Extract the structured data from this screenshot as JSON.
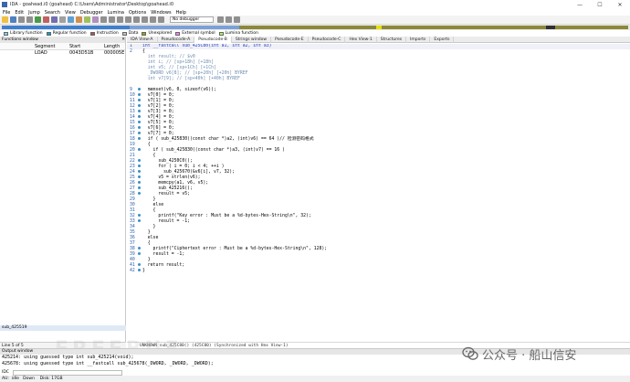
{
  "window": {
    "title": "IDA - goahead.i0 (goahead) C:\\Users\\Administrator\\Desktop\\goahead.i0",
    "controls": [
      "—",
      "☐",
      "✕"
    ]
  },
  "menu": [
    "File",
    "Edit",
    "Jump",
    "Search",
    "View",
    "Debugger",
    "Lumina",
    "Options",
    "Windows",
    "Help"
  ],
  "toolbar": {
    "debugger_select": "No debugger"
  },
  "legend": [
    {
      "label": "Library function",
      "color": "#7fd0ff"
    },
    {
      "label": "Regular function",
      "color": "#00a0d8"
    },
    {
      "label": "Instruction",
      "color": "#b05050"
    },
    {
      "label": "Data",
      "color": "#c0c0c0"
    },
    {
      "label": "Unexplored",
      "color": "#8fa800"
    },
    {
      "label": "External symbol",
      "color": "#ff80ff"
    },
    {
      "label": "Lumina function",
      "color": "#a0ff60"
    }
  ],
  "functions_window": {
    "title": "Functions window",
    "columns": [
      "Function name",
      "Segment",
      "Start",
      "Length"
    ],
    "rows": [
      {
        "name": "",
        "segment": "LOAD",
        "start": "0043D51B",
        "length": "000005E"
      }
    ],
    "selected": "sub_425519",
    "status": "Line 5 of 5"
  },
  "tabs": [
    {
      "label": "IDA View-A",
      "active": false
    },
    {
      "label": "Pseudocode-A",
      "active": false
    },
    {
      "label": "Pseudocode-B",
      "active": true
    },
    {
      "label": "Strings window",
      "active": false
    },
    {
      "label": "Pseudocode-E",
      "active": false
    },
    {
      "label": "Pseudocode-C",
      "active": false
    },
    {
      "label": "Hex View-1",
      "active": false
    },
    {
      "label": "Structures",
      "active": false
    },
    {
      "label": "Imports",
      "active": false
    },
    {
      "label": "Exports",
      "active": false
    }
  ],
  "code_lines": [
    {
      "n": "1",
      "dot": false,
      "text": "int __fastcall sub_425C80(int a1, int a2, int a3)",
      "cls": "sel"
    },
    {
      "n": "2",
      "dot": false,
      "text": "{"
    },
    {
      "n": "",
      "dot": false,
      "text": "  int result; // $v0",
      "cls": "grey"
    },
    {
      "n": "",
      "dot": false,
      "text": "  int i; // [sp+18h] [+18h]",
      "cls": "grey"
    },
    {
      "n": "",
      "dot": false,
      "text": "  int v5; // [sp+1Ch] [+1Ch]",
      "cls": "grey"
    },
    {
      "n": "",
      "dot": false,
      "text": "  _DWORD v6[8]; // [sp+20h] [+20h] BYREF",
      "cls": "grey"
    },
    {
      "n": "",
      "dot": false,
      "text": "  int v7[9]; // [sp+40h] [+40h] BYREF",
      "cls": "grey"
    },
    {
      "n": "",
      "dot": false,
      "text": ""
    },
    {
      "n": "9",
      "dot": true,
      "text": "  memset(v6, 0, sizeof(v6));"
    },
    {
      "n": "10",
      "dot": true,
      "text": "  v7[0] = 0;"
    },
    {
      "n": "11",
      "dot": true,
      "text": "  v7[1] = 0;"
    },
    {
      "n": "12",
      "dot": true,
      "text": "  v7[2] = 0;"
    },
    {
      "n": "13",
      "dot": true,
      "text": "  v7[3] = 0;"
    },
    {
      "n": "14",
      "dot": true,
      "text": "  v7[4] = 0;"
    },
    {
      "n": "15",
      "dot": true,
      "text": "  v7[5] = 0;"
    },
    {
      "n": "16",
      "dot": true,
      "text": "  v7[6] = 0;"
    },
    {
      "n": "17",
      "dot": true,
      "text": "  v7[7] = 0;"
    },
    {
      "n": "18",
      "dot": true,
      "text": "  if ( sub_425830((const char *)a2, (int)v6) == 64 )// 检测密码格式"
    },
    {
      "n": "19",
      "dot": false,
      "text": "  {"
    },
    {
      "n": "20",
      "dot": true,
      "text": "    if ( sub_425830((const char *)a3, (int)v7) == 16 )"
    },
    {
      "n": "21",
      "dot": false,
      "text": "    {"
    },
    {
      "n": "22",
      "dot": true,
      "text": "      sub_4250C0();"
    },
    {
      "n": "23",
      "dot": true,
      "text": "      for ( i = 0; i < 4; ++i )"
    },
    {
      "n": "24",
      "dot": true,
      "text": "        sub_425670(&v6[i], v7, 32);"
    },
    {
      "n": "25",
      "dot": true,
      "text": "      v5 = strlen(v6);"
    },
    {
      "n": "26",
      "dot": true,
      "text": "      memcpy(a1, v6, v5);"
    },
    {
      "n": "27",
      "dot": true,
      "text": "      sub_425216();"
    },
    {
      "n": "28",
      "dot": true,
      "text": "      result = v5;"
    },
    {
      "n": "29",
      "dot": false,
      "text": "    }"
    },
    {
      "n": "30",
      "dot": false,
      "text": "    else"
    },
    {
      "n": "31",
      "dot": false,
      "text": "    {"
    },
    {
      "n": "32",
      "dot": true,
      "text": "      printf(\"Key error : Must be a %d-bytes-Hex-String\\n\", 32);"
    },
    {
      "n": "33",
      "dot": true,
      "text": "      result = -1;"
    },
    {
      "n": "34",
      "dot": false,
      "text": "    }"
    },
    {
      "n": "35",
      "dot": false,
      "text": "  }"
    },
    {
      "n": "36",
      "dot": false,
      "text": "  else"
    },
    {
      "n": "37",
      "dot": false,
      "text": "  {"
    },
    {
      "n": "38",
      "dot": true,
      "text": "    printf(\"Ciphertext error : Must be a %d-bytes-Hex-String\\n\", 128);"
    },
    {
      "n": "39",
      "dot": true,
      "text": "    result = -1;"
    },
    {
      "n": "40",
      "dot": false,
      "text": "  }"
    },
    {
      "n": "41",
      "dot": true,
      "text": "  return result;"
    },
    {
      "n": "42",
      "dot": true,
      "text": "}"
    }
  ],
  "code_status": "UNKNOWN sub_425C80() (425C80) (Synchronized with Hex View-1)",
  "output": {
    "title": "Output window",
    "lines": [
      "425214: using guessed type int sub_425214(void);",
      "425678: using guessed type int __fastcall sub_425678(_DWORD, _DWORD, _DWORD);"
    ],
    "input_label": "IDC",
    "status": "AU:  idle   Down    Disk: 17GB"
  },
  "watermark": {
    "text": "公众号 · 船山信安"
  },
  "colors": {
    "nav_blue": "#3f7fd0",
    "nav_olive": "#8a8a3a",
    "nav_yellow": "#e8e000",
    "accent_dot": "#3a8fc7"
  }
}
